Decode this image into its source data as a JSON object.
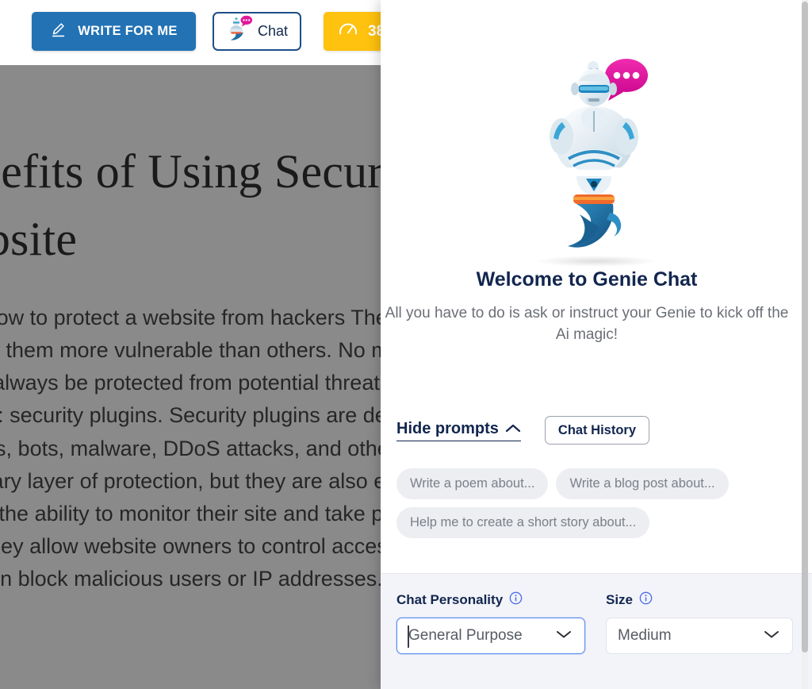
{
  "toolbar": {
    "write_for_me_label": "WRITE FOR ME",
    "chat_tab_label": "Chat",
    "credits_label": "38"
  },
  "article": {
    "heading": "Benefits of Using Security Plugins for Your Website",
    "body": "Learn how to protect a website from hackers The internet is filled with millions of websites, some of them more vulnerable than others. No matter what purpose your website is for, it should always be protected from potential threats and attacks. Fortunately, there is a reliable solution: security plugins. Security plugins are designed to protect your website from hacking attempts, bots, malware, DDoS attacks, and other security risks. Not only do they provide a necessary layer of protection, but they are also easy to use. Security plugins give website owners the ability to monitor their site and take proactive steps to ensure that their data stays safe. They allow website owners to control access to their website, restrict certain features, and even block malicious users or IP addresses."
  },
  "chat_panel": {
    "welcome_title": "Welcome to Genie Chat",
    "welcome_subtitle": "All you have to do is ask or instruct your Genie to kick off the Ai magic!",
    "hide_prompts_label": "Hide prompts",
    "chat_history_label": "Chat History",
    "prompts": [
      "Write a poem about...",
      "Write a blog post about...",
      "Help me to create a short story about..."
    ],
    "footer": {
      "personality_label": "Chat Personality",
      "personality_value": "General Purpose",
      "size_label": "Size",
      "size_value": "Medium"
    }
  },
  "colors": {
    "primary_blue": "#2272b4",
    "accent_yellow": "#ffc20e",
    "navy": "#12264f",
    "info_blue": "#4d6de8",
    "chip_gray": "#eceef1",
    "footer_bg": "#f3f4f9",
    "overlay_gray": "#8a8a8a"
  }
}
